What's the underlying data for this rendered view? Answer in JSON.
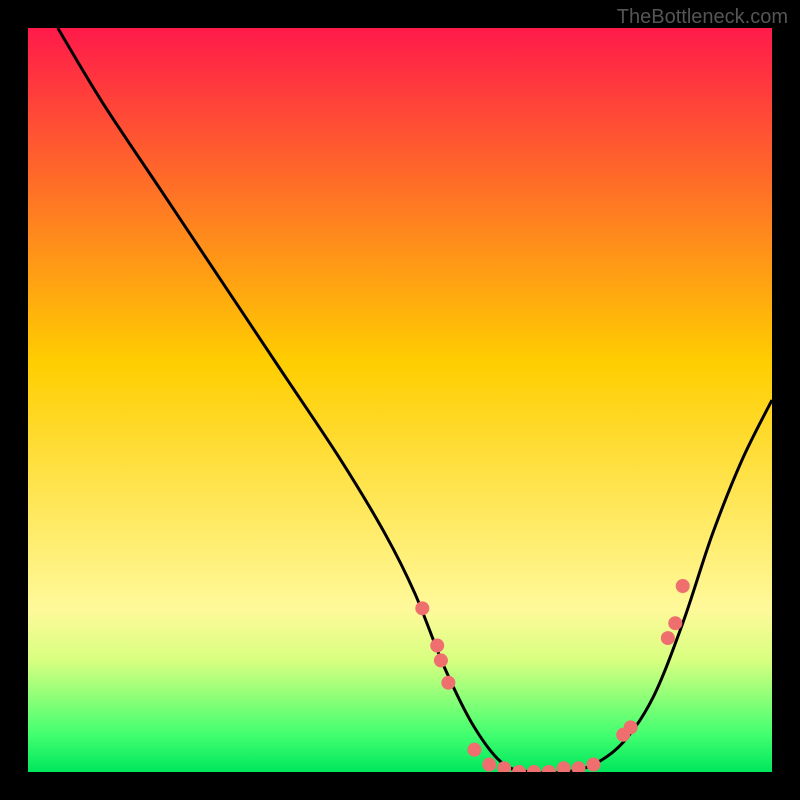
{
  "watermark": "TheBottleneck.com",
  "chart_data": {
    "type": "line",
    "title": "",
    "xlabel": "",
    "ylabel": "",
    "xlim": [
      0,
      100
    ],
    "ylim": [
      0,
      100
    ],
    "gradient_stops": [
      {
        "offset": 0,
        "color": "#ff1a4a"
      },
      {
        "offset": 45,
        "color": "#ffce00"
      },
      {
        "offset": 78,
        "color": "#fff99a"
      },
      {
        "offset": 85,
        "color": "#d8ff80"
      },
      {
        "offset": 95,
        "color": "#42ff70"
      },
      {
        "offset": 100,
        "color": "#00e65c"
      }
    ],
    "series": [
      {
        "name": "bottleneck-curve",
        "x": [
          4,
          10,
          18,
          26,
          34,
          42,
          48,
          52,
          56,
          60,
          64,
          68,
          72,
          76,
          80,
          84,
          88,
          92,
          96,
          100
        ],
        "y": [
          100,
          90,
          78,
          66,
          54,
          42,
          32,
          24,
          14,
          6,
          1,
          0,
          0,
          1,
          4,
          10,
          20,
          32,
          42,
          50
        ]
      }
    ],
    "markers": {
      "name": "highlight-points",
      "color": "#ef6f6f",
      "points": [
        {
          "x": 53,
          "y": 22
        },
        {
          "x": 55,
          "y": 17
        },
        {
          "x": 55.5,
          "y": 15
        },
        {
          "x": 56.5,
          "y": 12
        },
        {
          "x": 60,
          "y": 3
        },
        {
          "x": 62,
          "y": 1
        },
        {
          "x": 64,
          "y": 0.5
        },
        {
          "x": 66,
          "y": 0
        },
        {
          "x": 68,
          "y": 0
        },
        {
          "x": 70,
          "y": 0
        },
        {
          "x": 72,
          "y": 0.5
        },
        {
          "x": 74,
          "y": 0.5
        },
        {
          "x": 76,
          "y": 1
        },
        {
          "x": 80,
          "y": 5
        },
        {
          "x": 81,
          "y": 6
        },
        {
          "x": 86,
          "y": 18
        },
        {
          "x": 87,
          "y": 20
        },
        {
          "x": 88,
          "y": 25
        }
      ]
    }
  }
}
